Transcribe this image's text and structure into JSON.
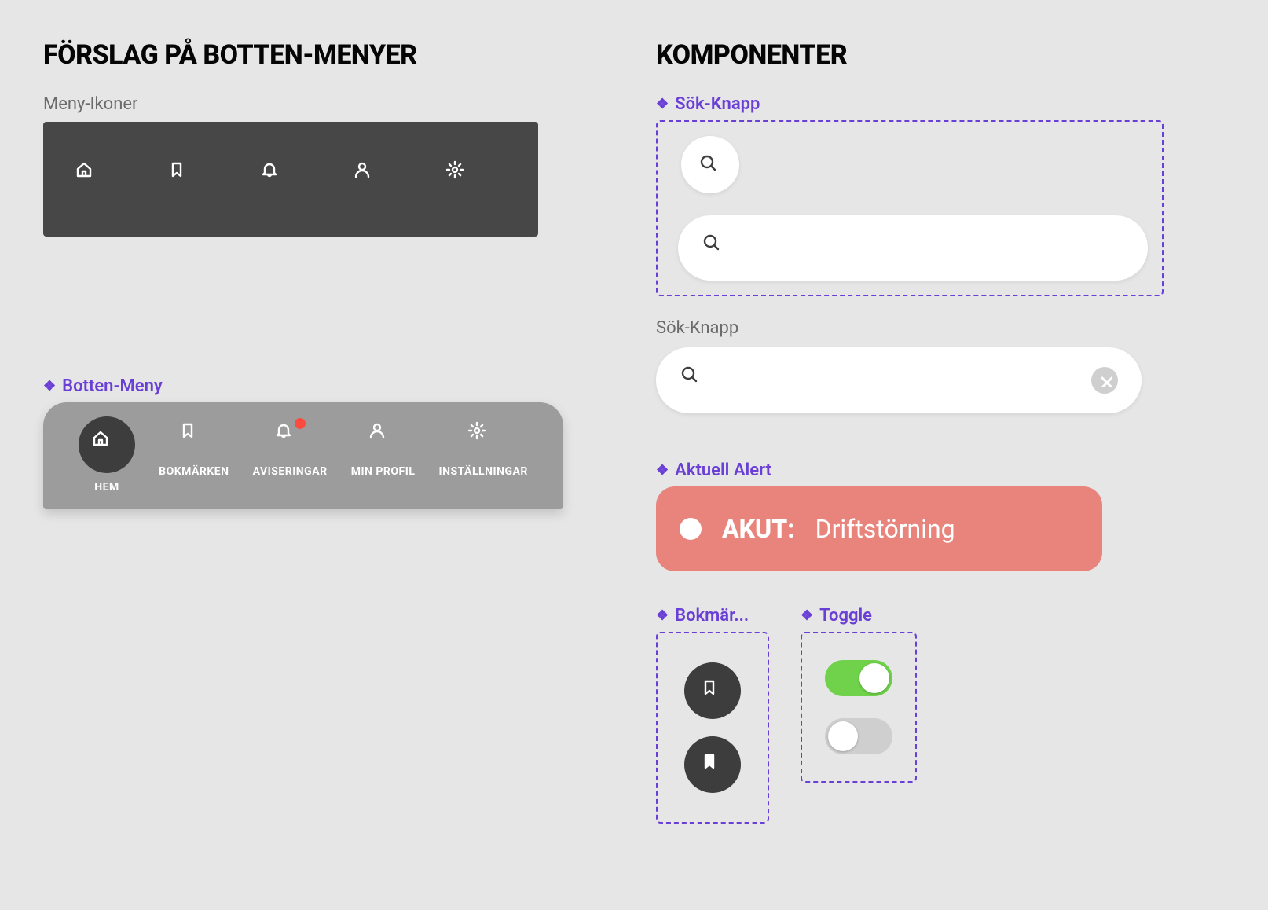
{
  "left": {
    "heading": "FÖRSLAG PÅ BOTTEN-MENYER",
    "icons_label": "Meny-Ikoner",
    "bottom_menu_label": "Botten-Meny",
    "menu_items": [
      {
        "label": "HEM"
      },
      {
        "label": "BOKMÄRKEN"
      },
      {
        "label": "AVISERINGAR"
      },
      {
        "label": "MIN PROFIL"
      },
      {
        "label": "INSTÄLLNINGAR"
      }
    ]
  },
  "right": {
    "heading": "KOMPONENTER",
    "sok_label": "Sök-Knapp",
    "sok_label_plain": "Sök-Knapp",
    "alert_label": "Aktuell Alert",
    "alert": {
      "prefix": "AKUT:",
      "message": "Driftstörning"
    },
    "bookmark_label": "Bokmär...",
    "toggle_label": "Toggle"
  }
}
